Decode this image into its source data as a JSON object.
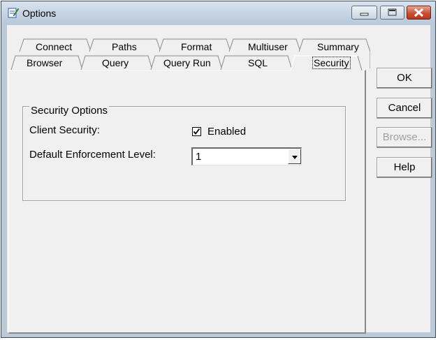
{
  "window": {
    "title": "Options"
  },
  "tabs": {
    "back_row": [
      "Connect",
      "Paths",
      "Format",
      "Multiuser",
      "Summary"
    ],
    "front_row": [
      "Browser",
      "Query",
      "Query Run",
      "SQL",
      "Security"
    ],
    "active": "Security"
  },
  "security": {
    "group_title": "Security Options",
    "client_security_label": "Client Security:",
    "client_security_checkbox_label": "Enabled",
    "client_security_checked": true,
    "enforcement_label": "Default Enforcement Level:",
    "enforcement_value": "1"
  },
  "buttons": {
    "ok": "OK",
    "cancel": "Cancel",
    "browse": "Browse...",
    "help": "Help"
  }
}
